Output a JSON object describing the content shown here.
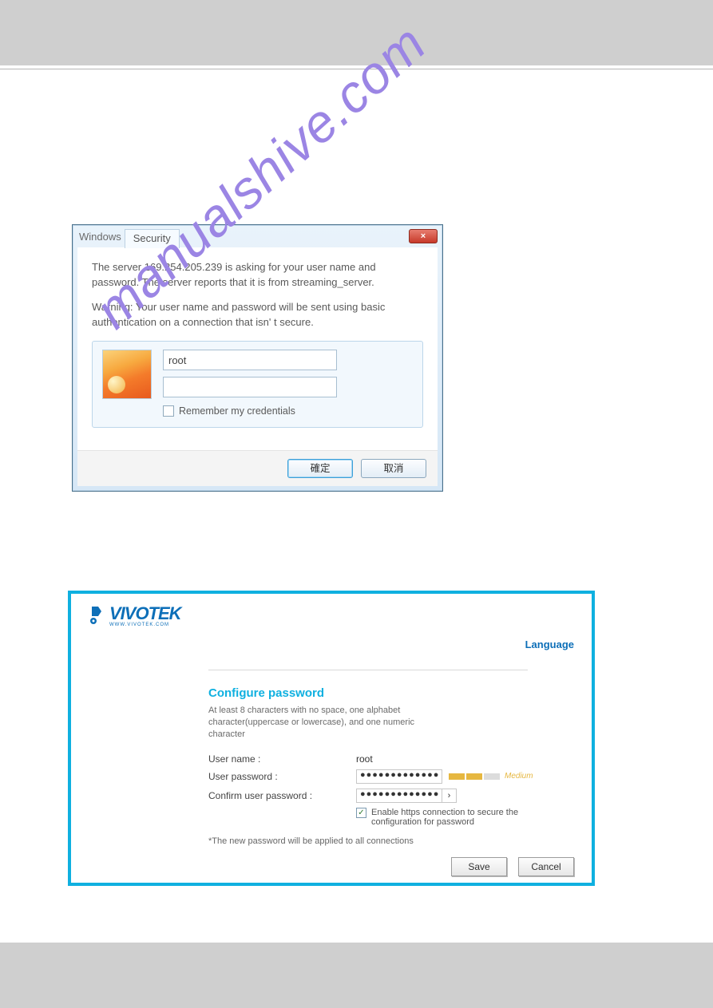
{
  "watermark": "manualshive.com",
  "windows_dialog": {
    "title_windows": "Windows",
    "title_tab": "Security",
    "close_icon": "×",
    "msg1": "The server 169.254.205.239 is asking for your user name and password. The server reports that it is from streaming_server.",
    "msg2": "Warning: Your user name and password will be sent using basic authentication on a connection that isn'  t secure.",
    "username_value": "root",
    "password_value": "",
    "remember_label": "Remember my credentials",
    "ok_button": "確定",
    "cancel_button": "取消"
  },
  "vivotek": {
    "logo_text": "VIVOTEK",
    "logo_sub": "WWW.VIVOTEK.COM",
    "language_link": "Language",
    "title": "Configure password",
    "hint": "At least 8 characters with no space, one alphabet character(uppercase or lowercase), and one numeric character",
    "username_label": "User name :",
    "username_value": "root",
    "password_label": "User password :",
    "password_value": "●●●●●●●●●●●●●",
    "strength_text": "Medium",
    "confirm_label": "Confirm user password :",
    "confirm_value": "●●●●●●●●●●●●●",
    "reveal_icon": "›",
    "https_label": "Enable https connection to secure the configuration for password",
    "note": "*The new password will be applied to all connections",
    "save_button": "Save",
    "cancel_button": "Cancel"
  }
}
